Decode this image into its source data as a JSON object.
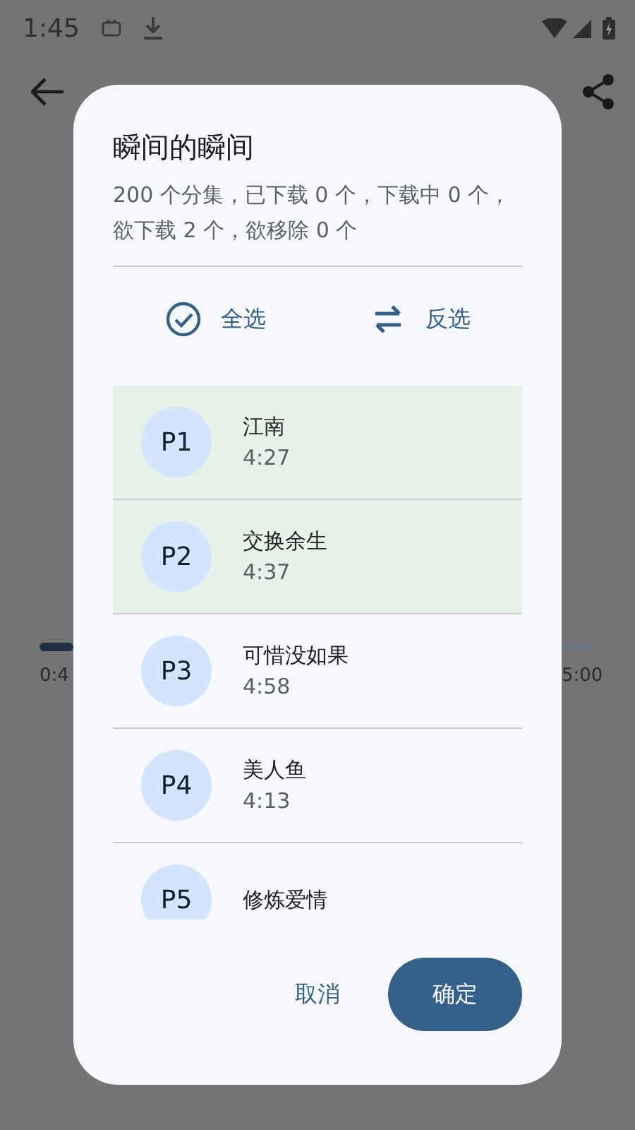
{
  "status_bar": {
    "time": "1:45"
  },
  "player": {
    "elapsed": "0:4",
    "total": "5:00",
    "level": 0.06
  },
  "dialog": {
    "title": "瞬间的瞬间",
    "summary": "200 个分集，已下载 0 个，下载中 0 个，欲下载 2 个，欲移除 0 个",
    "actions": [
      {
        "kind": "select-all",
        "label": "全选"
      },
      {
        "kind": "invert",
        "label": "反选"
      }
    ],
    "episodes": [
      {
        "badge": "P1",
        "title": "江南",
        "duration": "4:27",
        "selected": true
      },
      {
        "badge": "P2",
        "title": "交换余生",
        "duration": "4:37",
        "selected": true
      },
      {
        "badge": "P3",
        "title": "可惜没如果",
        "duration": "4:58",
        "selected": false
      },
      {
        "badge": "P4",
        "title": "美人鱼",
        "duration": "4:13",
        "selected": false
      },
      {
        "badge": "P5",
        "title": "修炼爱情",
        "selected": false
      }
    ],
    "cancel": "取消",
    "confirm": "确定"
  }
}
